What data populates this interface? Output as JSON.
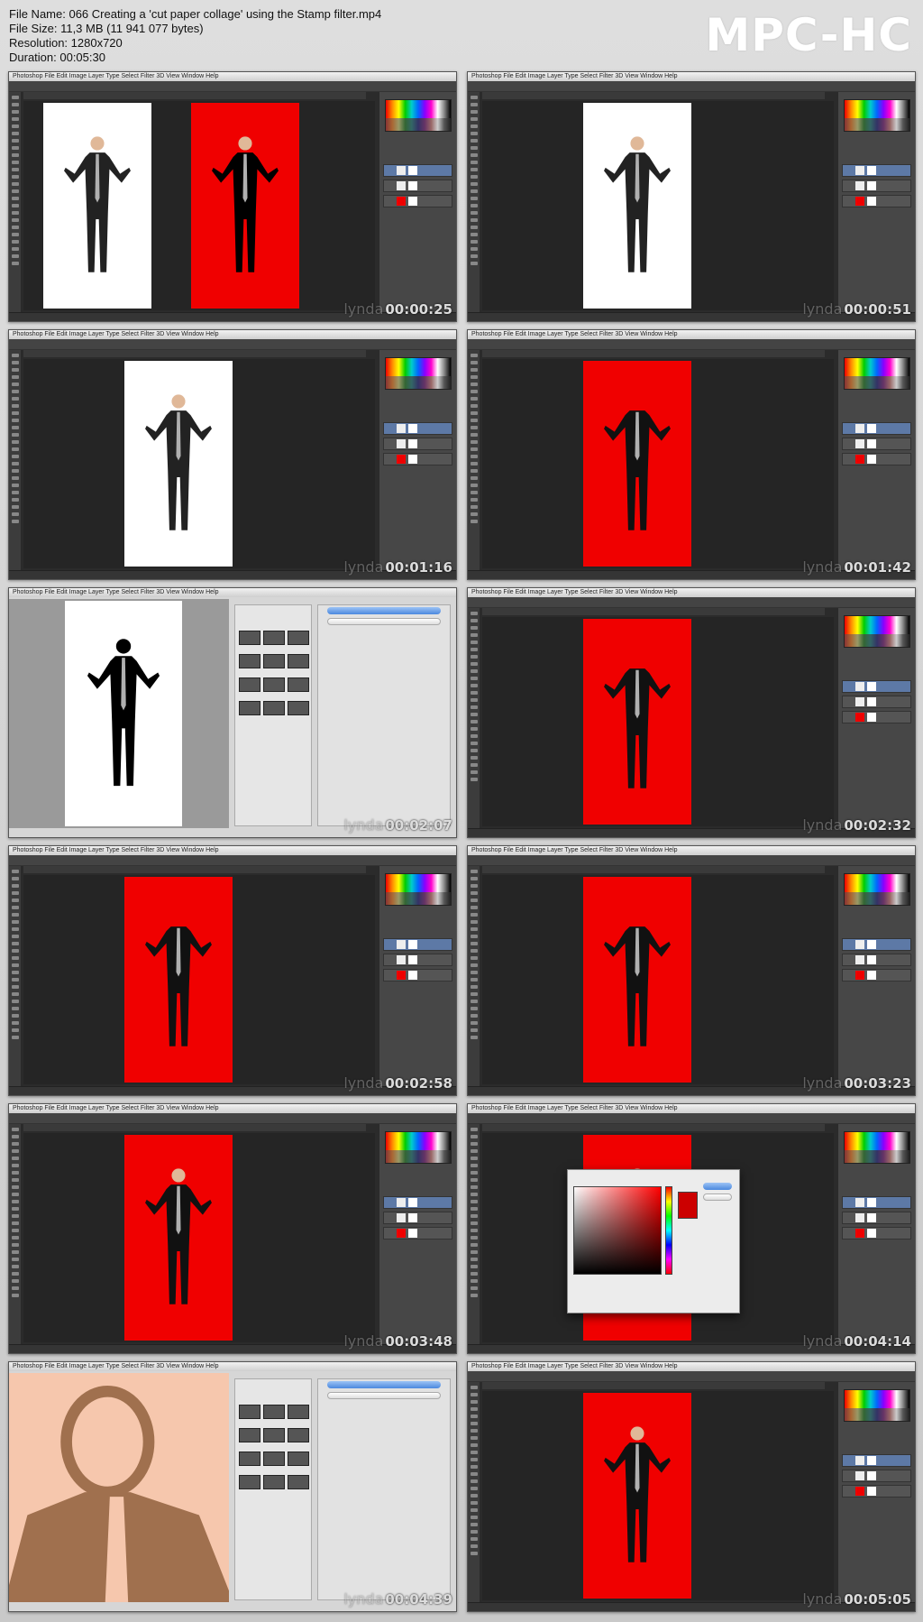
{
  "header": {
    "file_name": "File Name: 066 Creating a 'cut paper collage' using the Stamp filter.mp4",
    "file_size": "File Size: 11,3 MB (11 941 077 bytes)",
    "resolution": "Resolution: 1280x720",
    "duration": "Duration: 00:05:30"
  },
  "brand": "MPC-HC",
  "app_menu": "Photoshop  File  Edit  Image  Layer  Type  Select  Filter  3D  View  Window  Help",
  "watermark_brand": "lynda",
  "colors": {
    "red_canvas": "#f00000",
    "peach_canvas": "#f6c7ad",
    "dark_ui": "#2b2b2b"
  },
  "thumbnails": [
    {
      "timestamp": "00:00:25",
      "kind": "workspace",
      "docs": [
        "white",
        "red"
      ]
    },
    {
      "timestamp": "00:00:51",
      "kind": "workspace",
      "docs": [
        "white-center"
      ]
    },
    {
      "timestamp": "00:01:16",
      "kind": "workspace",
      "docs": [
        "white-center"
      ]
    },
    {
      "timestamp": "00:01:42",
      "kind": "workspace",
      "docs": [
        "red-center"
      ]
    },
    {
      "timestamp": "00:02:07",
      "kind": "filter-gallery",
      "docs": [
        "stamp-bw"
      ]
    },
    {
      "timestamp": "00:02:32",
      "kind": "workspace",
      "docs": [
        "red-center"
      ]
    },
    {
      "timestamp": "00:02:58",
      "kind": "workspace",
      "docs": [
        "red-center"
      ]
    },
    {
      "timestamp": "00:03:23",
      "kind": "workspace",
      "docs": [
        "red-center"
      ]
    },
    {
      "timestamp": "00:03:48",
      "kind": "workspace",
      "docs": [
        "red-center"
      ]
    },
    {
      "timestamp": "00:04:14",
      "kind": "color-picker",
      "docs": [
        "red-center"
      ]
    },
    {
      "timestamp": "00:04:39",
      "kind": "filter-gallery",
      "docs": [
        "peach-closeup"
      ]
    },
    {
      "timestamp": "00:05:05",
      "kind": "workspace",
      "docs": [
        "red-center"
      ]
    }
  ]
}
